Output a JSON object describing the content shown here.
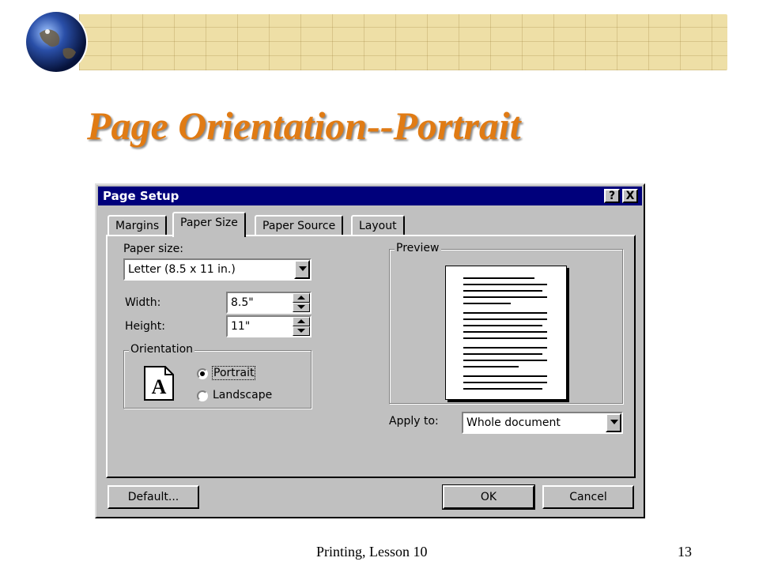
{
  "slide": {
    "title": "Page Orientation--Portrait",
    "footer": "Printing, Lesson 10",
    "page_number": "13"
  },
  "dialog": {
    "title": "Page Setup",
    "help_button": "?",
    "close_button": "X",
    "tabs": [
      {
        "label": "Margins",
        "selected": false
      },
      {
        "label": "Paper Size",
        "selected": true
      },
      {
        "label": "Paper Source",
        "selected": false
      },
      {
        "label": "Layout",
        "selected": false
      }
    ],
    "paper_size": {
      "label": "Paper size:",
      "value": "Letter (8.5 x 11 in.)"
    },
    "width": {
      "label": "Width:",
      "value": "8.5\""
    },
    "height": {
      "label": "Height:",
      "value": "11\""
    },
    "orientation": {
      "label": "Orientation",
      "icon_letter": "A",
      "options": [
        {
          "label": "Portrait",
          "checked": true
        },
        {
          "label": "Landscape",
          "checked": false
        }
      ]
    },
    "preview": {
      "label": "Preview"
    },
    "apply_to": {
      "label": "Apply to:",
      "value": "Whole document"
    },
    "buttons": {
      "default": "Default...",
      "ok": "OK",
      "cancel": "Cancel"
    }
  },
  "colors": {
    "title_orange": "#e07b14",
    "titlebar_blue": "#00007b",
    "dialog_gray": "#c0c0c0",
    "banner_tan": "#eedfa6"
  },
  "icons": [
    "globe-icon",
    "help-icon",
    "close-icon",
    "portrait-page-icon",
    "dropdown-arrow-icon",
    "spinner-icon"
  ]
}
